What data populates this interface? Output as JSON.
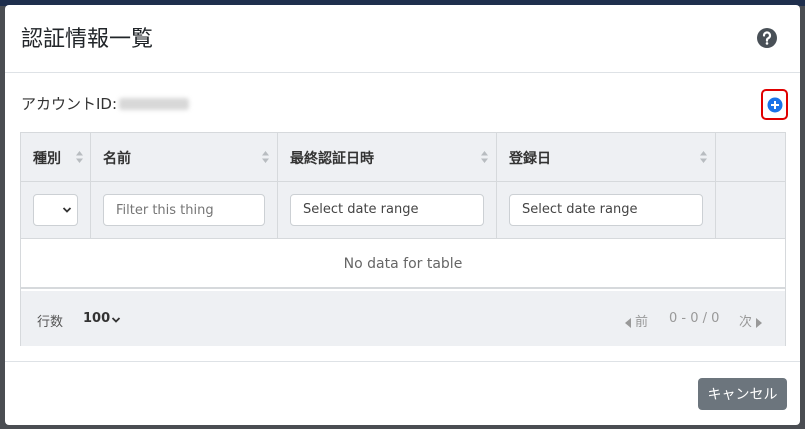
{
  "modal": {
    "title": "認証情報一覧",
    "help_icon": "question-circle-icon",
    "account_label": "アカウントID:",
    "add_icon": "plus-circle-icon",
    "accent": "#1a73e8",
    "highlight_border": "#e00000"
  },
  "table": {
    "columns": [
      {
        "label": "種別"
      },
      {
        "label": "名前"
      },
      {
        "label": "最終認証日時"
      },
      {
        "label": "登録日"
      }
    ],
    "filters": {
      "name_placeholder": "Filter this thing",
      "last_auth_value": "Select date range",
      "registered_value": "Select date range"
    },
    "empty_text": "No data for table"
  },
  "pagination": {
    "rows_label": "行数",
    "rows_value": "100",
    "prev_label": "前",
    "page_info": "0 - 0 / 0",
    "next_label": "次"
  },
  "footer": {
    "cancel_label": "キャンセル"
  }
}
